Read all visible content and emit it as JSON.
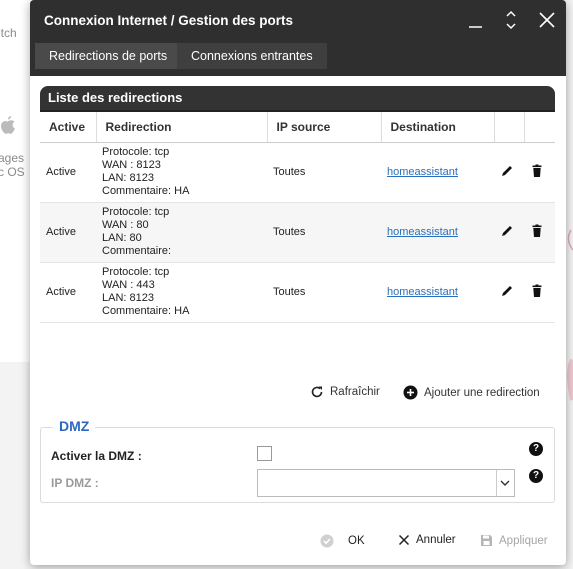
{
  "background": {
    "label_top": "itch",
    "label_mid": "ages",
    "label_mid2": "c OS"
  },
  "dialog": {
    "title": "Connexion Internet / Gestion des ports",
    "tabs": [
      {
        "label": "Redirections de ports",
        "active": true
      },
      {
        "label": "Connexions entrantes",
        "active": false
      }
    ]
  },
  "redirections": {
    "title": "Liste des redirections",
    "columns": [
      "Active",
      "Redirection",
      "IP source",
      "Destination",
      "",
      ""
    ],
    "rows": [
      {
        "active": "Active",
        "protocol": "Protocole: tcp",
        "wan": "WAN : 8123",
        "lan": "LAN: 8123",
        "comment": "Commentaire: HA",
        "ip_source": "Toutes",
        "destination": "homeassistant"
      },
      {
        "active": "Active",
        "protocol": "Protocole: tcp",
        "wan": "WAN : 80",
        "lan": "LAN: 80",
        "comment": "Commentaire:",
        "ip_source": "Toutes",
        "destination": "homeassistant"
      },
      {
        "active": "Active",
        "protocol": "Protocole: tcp",
        "wan": "WAN : 443",
        "lan": "LAN: 8123",
        "comment": "Commentaire: HA",
        "ip_source": "Toutes",
        "destination": "homeassistant"
      }
    ],
    "refresh_label": "Rafraîchir",
    "add_label": "Ajouter une redirection"
  },
  "dmz": {
    "legend": "DMZ",
    "enable_label": "Activer la DMZ :",
    "ip_label": "IP DMZ :",
    "ip_value": "",
    "help": "?"
  },
  "footer": {
    "ok_label": "OK",
    "cancel_label": "Annuler",
    "apply_label": "Appliquer"
  },
  "colors": {
    "titlebar": "#2f2f2f",
    "link": "#2a6fbd",
    "dmz_legend": "#2d66c2"
  }
}
